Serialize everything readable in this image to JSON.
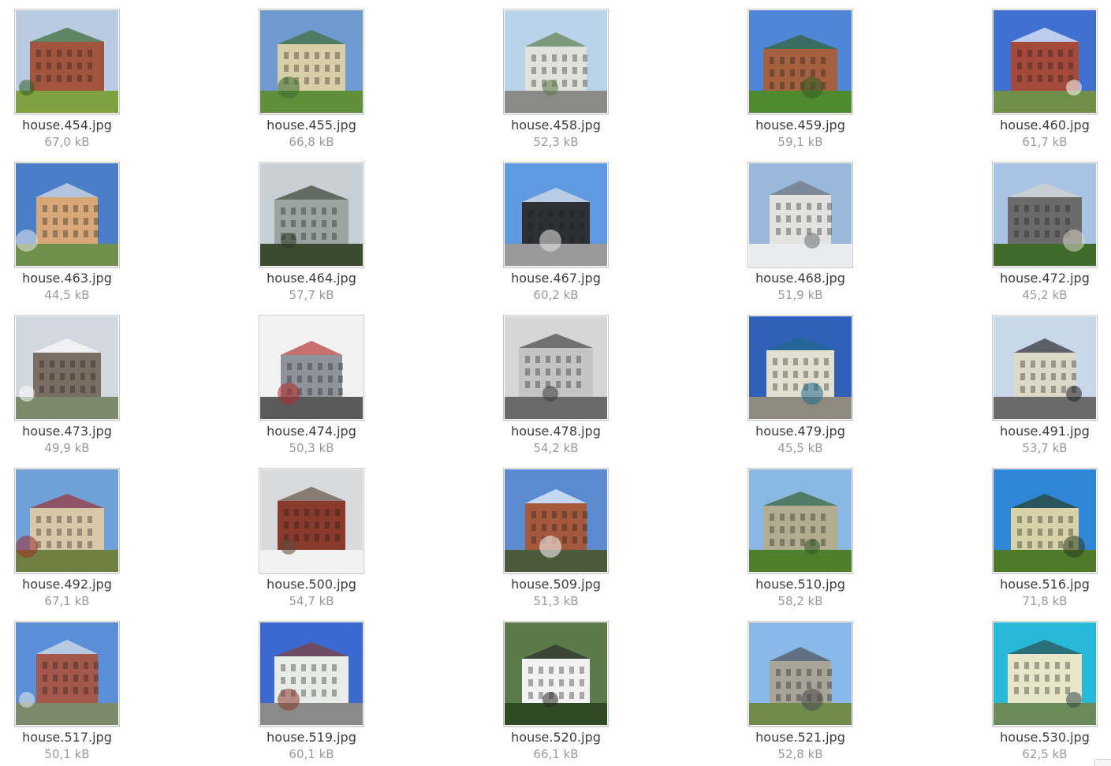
{
  "files": [
    {
      "name": "house.454.jpg",
      "size": "67,0 kB",
      "palette": {
        "sky": "#b8cbe0",
        "ground": "#7fa040",
        "building": "#a0553c",
        "accent": "#2f5f24"
      }
    },
    {
      "name": "house.455.jpg",
      "size": "66,8 kB",
      "palette": {
        "sky": "#6f9ad0",
        "ground": "#5f8f3a",
        "building": "#d8cfa8",
        "accent": "#3a6a2a"
      }
    },
    {
      "name": "house.458.jpg",
      "size": "52,3 kB",
      "palette": {
        "sky": "#b9d3ea",
        "ground": "#8a8a88",
        "building": "#e2e2dc",
        "accent": "#5a7a40"
      }
    },
    {
      "name": "house.459.jpg",
      "size": "59,1 kB",
      "palette": {
        "sky": "#4f86d8",
        "ground": "#4f8a2e",
        "building": "#a4603f",
        "accent": "#2f5f24"
      }
    },
    {
      "name": "house.460.jpg",
      "size": "61,7 kB",
      "palette": {
        "sky": "#3f6fd0",
        "ground": "#6f8f4a",
        "building": "#a44a3a",
        "accent": "#ffffff"
      }
    },
    {
      "name": "house.463.jpg",
      "size": "44,5 kB",
      "palette": {
        "sky": "#4a7fc8",
        "ground": "#6f8f4a",
        "building": "#d8a878",
        "accent": "#eaeaea"
      }
    },
    {
      "name": "house.464.jpg",
      "size": "57,7 kB",
      "palette": {
        "sky": "#c8d0d6",
        "ground": "#3a4a30",
        "building": "#9aa4a0",
        "accent": "#2a3424"
      }
    },
    {
      "name": "house.467.jpg",
      "size": "60,2 kB",
      "palette": {
        "sky": "#5f9ae0",
        "ground": "#9a9a9a",
        "building": "#2f3034",
        "accent": "#e8e8e8"
      }
    },
    {
      "name": "house.468.jpg",
      "size": "51,9 kB",
      "palette": {
        "sky": "#9ab8dc",
        "ground": "#e8ecef",
        "building": "#e2e2e0",
        "accent": "#6a6e72"
      }
    },
    {
      "name": "house.472.jpg",
      "size": "45,2 kB",
      "palette": {
        "sky": "#a8c4e4",
        "ground": "#3f6a2a",
        "building": "#6a6a6a",
        "accent": "#d8d4c8"
      }
    },
    {
      "name": "house.473.jpg",
      "size": "49,9 kB",
      "palette": {
        "sky": "#d2d8e0",
        "ground": "#7a8a6a",
        "building": "#7a6e62",
        "accent": "#ffffff"
      }
    },
    {
      "name": "house.474.jpg",
      "size": "50,3 kB",
      "palette": {
        "sky": "#f2f2f2",
        "ground": "#5a5a5a",
        "building": "#8f949c",
        "accent": "#b02a2a"
      }
    },
    {
      "name": "house.478.jpg",
      "size": "54,2 kB",
      "palette": {
        "sky": "#d6d6d6",
        "ground": "#6a6a6a",
        "building": "#c4c4c4",
        "accent": "#3a3a3a"
      }
    },
    {
      "name": "house.479.jpg",
      "size": "45,5 kB",
      "palette": {
        "sky": "#3060b8",
        "ground": "#8f8a80",
        "building": "#e4e0d0",
        "accent": "#1f6a8a"
      }
    },
    {
      "name": "house.491.jpg",
      "size": "53,7 kB",
      "palette": {
        "sky": "#c8d8ea",
        "ground": "#6a6a6a",
        "building": "#ded8c8",
        "accent": "#202020"
      }
    },
    {
      "name": "house.492.jpg",
      "size": "67,1 kB",
      "palette": {
        "sky": "#6fa0d8",
        "ground": "#6f8040",
        "building": "#d8c8a8",
        "accent": "#a02a2a"
      }
    },
    {
      "name": "house.500.jpg",
      "size": "54,7 kB",
      "palette": {
        "sky": "#d8dadc",
        "ground": "#f2f2f2",
        "building": "#8a3a2a",
        "accent": "#5a4a3a"
      }
    },
    {
      "name": "house.509.jpg",
      "size": "51,3 kB",
      "palette": {
        "sky": "#5a8ad0",
        "ground": "#4a5a3a",
        "building": "#a4583c",
        "accent": "#ffffff"
      }
    },
    {
      "name": "house.510.jpg",
      "size": "58,2 kB",
      "palette": {
        "sky": "#8ab8e4",
        "ground": "#4f7f2a",
        "building": "#b4ac90",
        "accent": "#2f5a24"
      }
    },
    {
      "name": "house.516.jpg",
      "size": "71,8 kB",
      "palette": {
        "sky": "#2f86d8",
        "ground": "#4f7a2a",
        "building": "#d8d2a8",
        "accent": "#2a3a1a"
      }
    },
    {
      "name": "house.517.jpg",
      "size": "50,1 kB",
      "palette": {
        "sky": "#5a8fd8",
        "ground": "#7a8a6a",
        "building": "#a4584a",
        "accent": "#eaeaea"
      }
    },
    {
      "name": "house.519.jpg",
      "size": "60,1 kB",
      "palette": {
        "sky": "#3a6ad0",
        "ground": "#8a8a8a",
        "building": "#e8ece8",
        "accent": "#8a3a2a"
      }
    },
    {
      "name": "house.520.jpg",
      "size": "66,1 kB",
      "palette": {
        "sky": "#5a7a4a",
        "ground": "#2f4a24",
        "building": "#f2f2f2",
        "accent": "#2a2a2a"
      }
    },
    {
      "name": "house.521.jpg",
      "size": "52,8 kB",
      "palette": {
        "sky": "#8ab8e8",
        "ground": "#6f8a4a",
        "building": "#a8a498",
        "accent": "#4a4a4a"
      }
    },
    {
      "name": "house.530.jpg",
      "size": "62,5 kB",
      "palette": {
        "sky": "#2ab8d8",
        "ground": "#6a8a5a",
        "building": "#e8e6c8",
        "accent": "#2a4a4a"
      }
    }
  ]
}
